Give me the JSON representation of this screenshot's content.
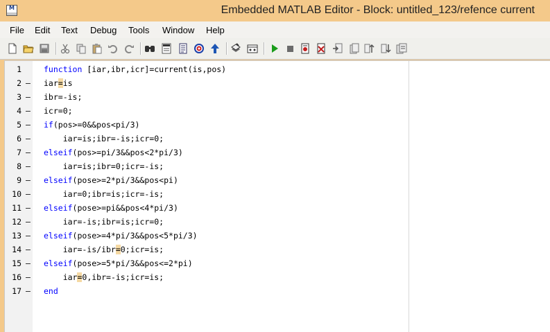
{
  "window": {
    "title": "Embedded MATLAB Editor - Block: untitled_123/refence current",
    "app_icon_label": "M"
  },
  "menu": [
    {
      "label": "File"
    },
    {
      "label": "Edit"
    },
    {
      "label": "Text"
    },
    {
      "label": "Debug"
    },
    {
      "label": "Tools"
    },
    {
      "label": "Window"
    },
    {
      "label": "Help"
    }
  ],
  "toolbar": {
    "icons": [
      "new-file-icon",
      "open-folder-icon",
      "save-icon",
      "cut-icon",
      "copy-icon",
      "paste-icon",
      "undo-icon",
      "redo-icon",
      "find-icon",
      "go-to-icon",
      "properties-icon",
      "target-icon",
      "arrow-up-icon",
      "build-icon",
      "model-explorer-icon",
      "run-icon",
      "stop-icon",
      "step-icon",
      "clear-breakpoints-icon",
      "step-in-icon",
      "step-over-icon",
      "step-out-icon",
      "stack-icon",
      "breakpoints-icon"
    ]
  },
  "editor": {
    "lines": [
      {
        "num": "1",
        "dash": "",
        "segments": [
          {
            "text": "function",
            "kw": true
          },
          {
            "text": " [iar,ibr,icr]=current(is,pos)"
          }
        ]
      },
      {
        "num": "2",
        "dash": "–",
        "segments": [
          {
            "text": "iar"
          },
          {
            "text": "=",
            "hl": true
          },
          {
            "text": "is"
          }
        ]
      },
      {
        "num": "3",
        "dash": "–",
        "segments": [
          {
            "text": "ibr=-is;"
          }
        ]
      },
      {
        "num": "4",
        "dash": "–",
        "segments": [
          {
            "text": "icr=0;"
          }
        ]
      },
      {
        "num": "5",
        "dash": "–",
        "segments": [
          {
            "text": "if",
            "kw": true
          },
          {
            "text": "(pos>=0&&pos<pi/3)"
          }
        ]
      },
      {
        "num": "6",
        "dash": "–",
        "segments": [
          {
            "text": "    iar=is;ibr=-is;icr=0;"
          }
        ]
      },
      {
        "num": "7",
        "dash": "–",
        "segments": [
          {
            "text": "elseif",
            "kw": true
          },
          {
            "text": "(pos>=pi/3&&pos<2*pi/3)"
          }
        ]
      },
      {
        "num": "8",
        "dash": "–",
        "segments": [
          {
            "text": "    iar=is;ibr=0;icr=-is;"
          }
        ]
      },
      {
        "num": "9",
        "dash": "–",
        "segments": [
          {
            "text": "elseif",
            "kw": true
          },
          {
            "text": "(pose>=2*pi/3&&pos<pi)"
          }
        ]
      },
      {
        "num": "10",
        "dash": "–",
        "segments": [
          {
            "text": "    iar=0;ibr=is;icr=-is;"
          }
        ]
      },
      {
        "num": "11",
        "dash": "–",
        "segments": [
          {
            "text": "elseif",
            "kw": true
          },
          {
            "text": "(pose>=pi&&pos<4*pi/3)"
          }
        ]
      },
      {
        "num": "12",
        "dash": "–",
        "segments": [
          {
            "text": "    iar=-is;ibr=is;icr=0;"
          }
        ]
      },
      {
        "num": "13",
        "dash": "–",
        "segments": [
          {
            "text": "elseif",
            "kw": true
          },
          {
            "text": "(pose>=4*pi/3&&pos<5*pi/3)"
          }
        ]
      },
      {
        "num": "14",
        "dash": "–",
        "segments": [
          {
            "text": "    iar=-is/ibr"
          },
          {
            "text": "=",
            "hl": true
          },
          {
            "text": "0;icr=is;"
          }
        ]
      },
      {
        "num": "15",
        "dash": "–",
        "segments": [
          {
            "text": "elseif",
            "kw": true
          },
          {
            "text": "(pose>=5*pi/3&&pos<=2*pi)"
          }
        ]
      },
      {
        "num": "16",
        "dash": "–",
        "segments": [
          {
            "text": "    iar"
          },
          {
            "text": "=",
            "hl": true
          },
          {
            "text": "0,ibr=-is;icr=is;"
          }
        ]
      },
      {
        "num": "17",
        "dash": "–",
        "segments": [
          {
            "text": "end",
            "kw": true
          }
        ]
      }
    ]
  }
}
